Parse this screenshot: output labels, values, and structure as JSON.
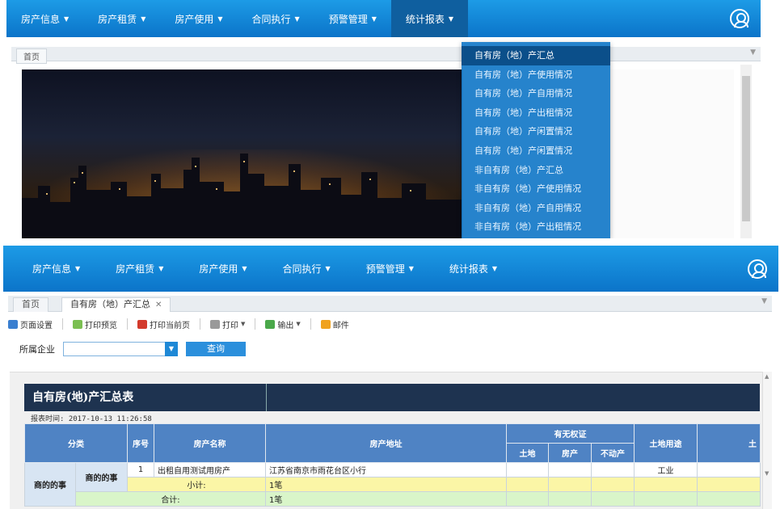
{
  "nav": {
    "items": [
      "房产信息",
      "房产租赁",
      "房产使用",
      "合同执行",
      "预警管理",
      "统计报表"
    ],
    "active_index": 5
  },
  "shot1": {
    "home_tab": "首页",
    "dropdown": [
      "自有房（地）产汇总",
      "自有房（地）产使用情况",
      "自有房（地）产自用情况",
      "自有房（地）产出租情况",
      "自有房（地）产闲置情况",
      "自有房（地）产闲置情况",
      "非自有房（地）产汇总",
      "非自有房（地）产使用情况",
      "非自有房（地）产自用情况",
      "非自有房（地）产出租情况"
    ]
  },
  "shot2": {
    "tabs": {
      "home": "首页",
      "current": "自有房（地）产汇总"
    },
    "toolbar": [
      "页面设置",
      "打印预览",
      "打印当前页",
      "打印",
      "输出",
      "邮件"
    ],
    "filter": {
      "label": "所属企业",
      "query": "查询"
    },
    "report": {
      "title": "自有房(地)产汇总表",
      "time": "报表时间: 2017-10-13 11:26:58",
      "headers": {
        "category": "分类",
        "index": "序号",
        "name": "房产名称",
        "address": "房产地址",
        "cert": "有无权证",
        "land": "土地",
        "house": "房产",
        "realestate": "不动产",
        "landuse": "土地用途",
        "extra": "土"
      },
      "category_main": "商的的事",
      "category_sub": "商的的事",
      "row": {
        "index": "1",
        "name": "出租自用测试用房产",
        "address": "江苏省南京市雨花台区小行",
        "landuse": "工业"
      },
      "subtotal_label": "小计:",
      "subtotal_value": "1笔",
      "total_label": "合计:",
      "total_value": "1笔"
    }
  }
}
